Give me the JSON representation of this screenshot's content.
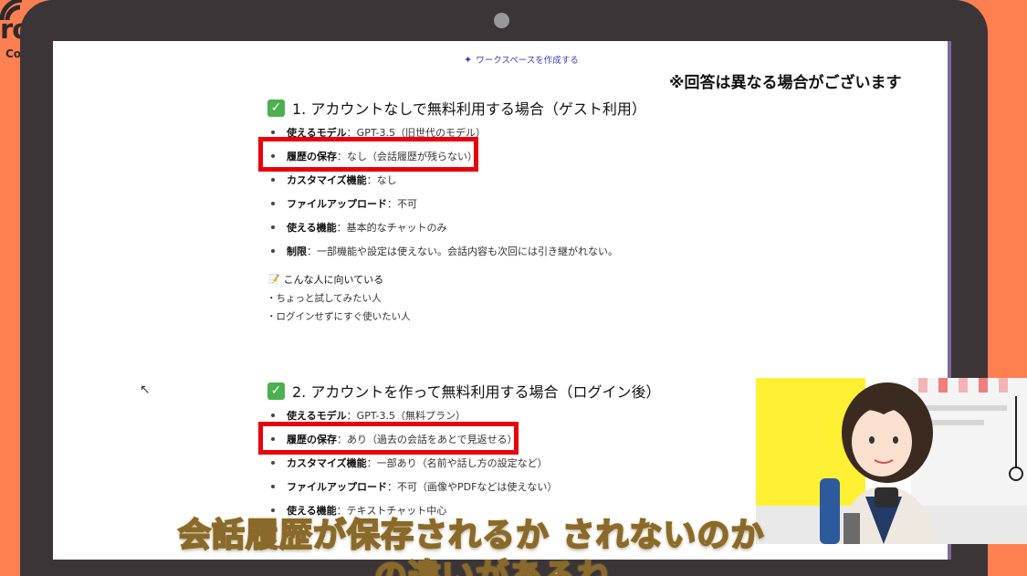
{
  "logo": {
    "title": "rowth",
    "subtitle": "College"
  },
  "workspace_link": {
    "icon": "sparkle-icon",
    "label": "ワークスペースを作成する"
  },
  "note": "※回答は異なる場合がございます",
  "section1": {
    "title": "1. アカウントなしで無料利用する場合（ゲスト利用）",
    "items": [
      {
        "key": "使えるモデル",
        "value": "：GPT-3.5（旧世代のモデル）"
      },
      {
        "key": "履歴の保存",
        "value": "：なし（会話履歴が残らない）"
      },
      {
        "key": "カスタマイズ機能",
        "value": "：なし"
      },
      {
        "key": "ファイルアップロード",
        "value": "：不可"
      },
      {
        "key": "使える機能",
        "value": "：基本的なチャットのみ"
      },
      {
        "key": "制限",
        "value": "：一部機能や設定は使えない。会話内容も次回には引き継がれない。"
      }
    ],
    "sub_heading": "こんな人に向いている",
    "sub_items": [
      "・ちょっと試してみたい人",
      "・ログインせずにすぐ使いたい人"
    ]
  },
  "section2": {
    "title": "2. アカウントを作って無料利用する場合（ログイン後）",
    "items": [
      {
        "key": "使えるモデル",
        "value": "：GPT-3.5（無料プラン）"
      },
      {
        "key": "履歴の保存",
        "value": "：あり（過去の会話をあとで見返せる）"
      },
      {
        "key": "カスタマイズ機能",
        "value": "：一部あり（名前や話し方の設定など）"
      },
      {
        "key": "ファイルアップロード",
        "value": "：不可（画像やPDFなどは使えない）"
      },
      {
        "key": "使える機能",
        "value": "：テキストチャット中心"
      }
    ]
  },
  "captions": {
    "line1": "会話履歴が保存されるか されないのか",
    "line2": "の違いがあるね"
  },
  "colors": {
    "background": "#ff7f50",
    "highlight": "#e8000b",
    "check": "#4caf50"
  }
}
